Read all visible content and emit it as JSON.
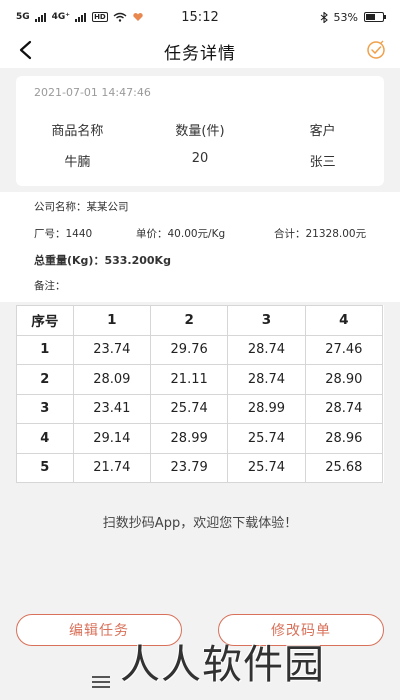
{
  "status_bar": {
    "signal_5g": "5G",
    "signal_4g": "4G⁺",
    "hd": "HD",
    "time": "15:12",
    "battery": "53%"
  },
  "nav": {
    "title": "任务详情"
  },
  "header": {
    "timestamp": "2021-07-01 14:47:46",
    "columns": [
      "商品名称",
      "数量(件)",
      "客户"
    ],
    "values": [
      "牛腩",
      "20",
      "张三"
    ]
  },
  "info": {
    "company": "公司名称：某某公司",
    "factory": "厂号：1440",
    "unit_price": "单价：40.00元/Kg",
    "total": "合计：21328.00元",
    "total_weight": "总重量(Kg)：533.200Kg",
    "remark": "备注："
  },
  "table": {
    "headers": [
      "序号",
      "1",
      "2",
      "3",
      "4"
    ],
    "rows": [
      [
        "1",
        "23.74",
        "29.76",
        "28.74",
        "27.46"
      ],
      [
        "2",
        "28.09",
        "21.11",
        "28.74",
        "28.90"
      ],
      [
        "3",
        "23.41",
        "25.74",
        "28.99",
        "28.74"
      ],
      [
        "4",
        "29.14",
        "28.99",
        "25.74",
        "28.96"
      ],
      [
        "5",
        "21.74",
        "23.79",
        "25.74",
        "25.68"
      ]
    ]
  },
  "welcome": "扫数抄码App，欢迎您下载体验！",
  "buttons": {
    "edit": "编辑任务",
    "modify": "修改码单"
  },
  "watermark": "人人软件园",
  "colors": {
    "accent": "#d9715a",
    "check_icon": "#f0a04b"
  },
  "icons": {
    "back": "chevron-left-icon",
    "confirm": "check-circle-icon",
    "menu": "menu-icon"
  }
}
